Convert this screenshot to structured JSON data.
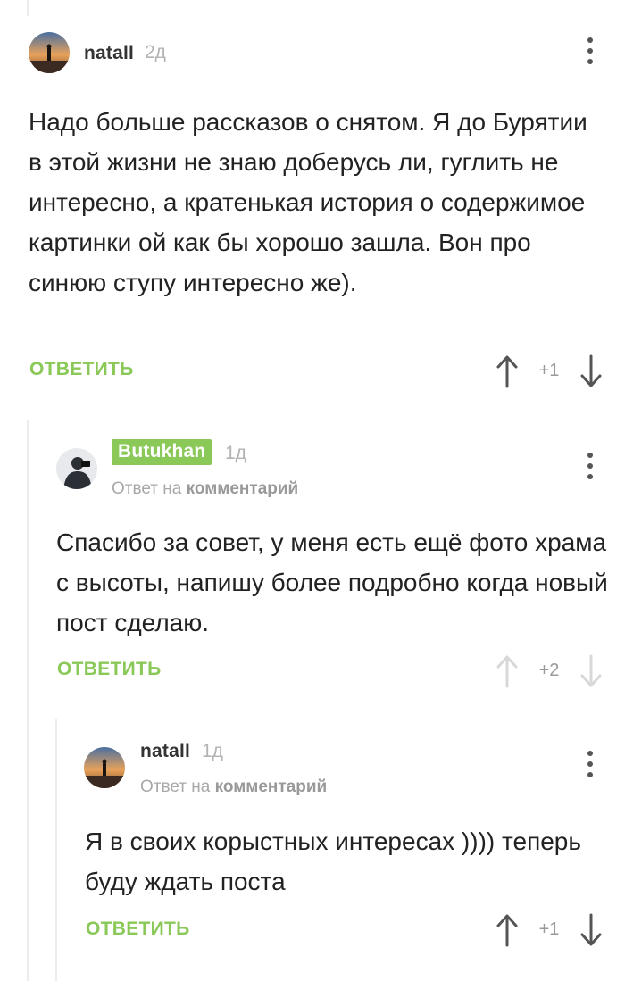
{
  "reply_label": "ОТВЕТИТЬ",
  "comments": [
    {
      "author": "natall",
      "age": "2д",
      "text": "Надо больше рассказов о снятом. Я до Бурятии в этой жизни не знаю доберусь ли, гуглить не интересно, а кратенькая история о содержимое картинки ой как бы хорошо зашла. Вон про синюю ступу интересно же).",
      "score": "+1",
      "avatar_icon": "sunset-silhouette-avatar"
    },
    {
      "author": "Butukhan",
      "author_badge": true,
      "age": "1д",
      "reply_prefix": "Ответ на",
      "reply_target": "комментарий",
      "text": "Спасибо за совет, у меня есть ещё фото храма с высоты, напишу более подробно когда новый пост сделаю.",
      "score": "+2",
      "avatar_icon": "photographer-avatar"
    },
    {
      "author": "natall",
      "age": "1д",
      "reply_prefix": "Ответ на",
      "reply_target": "комментарий",
      "text": "Я в своих корыстных интересах )))) теперь буду ждать поста",
      "score": "+1",
      "avatar_icon": "sunset-silhouette-avatar"
    }
  ],
  "colors": {
    "accent_green": "#8ac858",
    "text": "#222222",
    "muted": "#b3b3b3",
    "thread_line": "#ececec"
  }
}
